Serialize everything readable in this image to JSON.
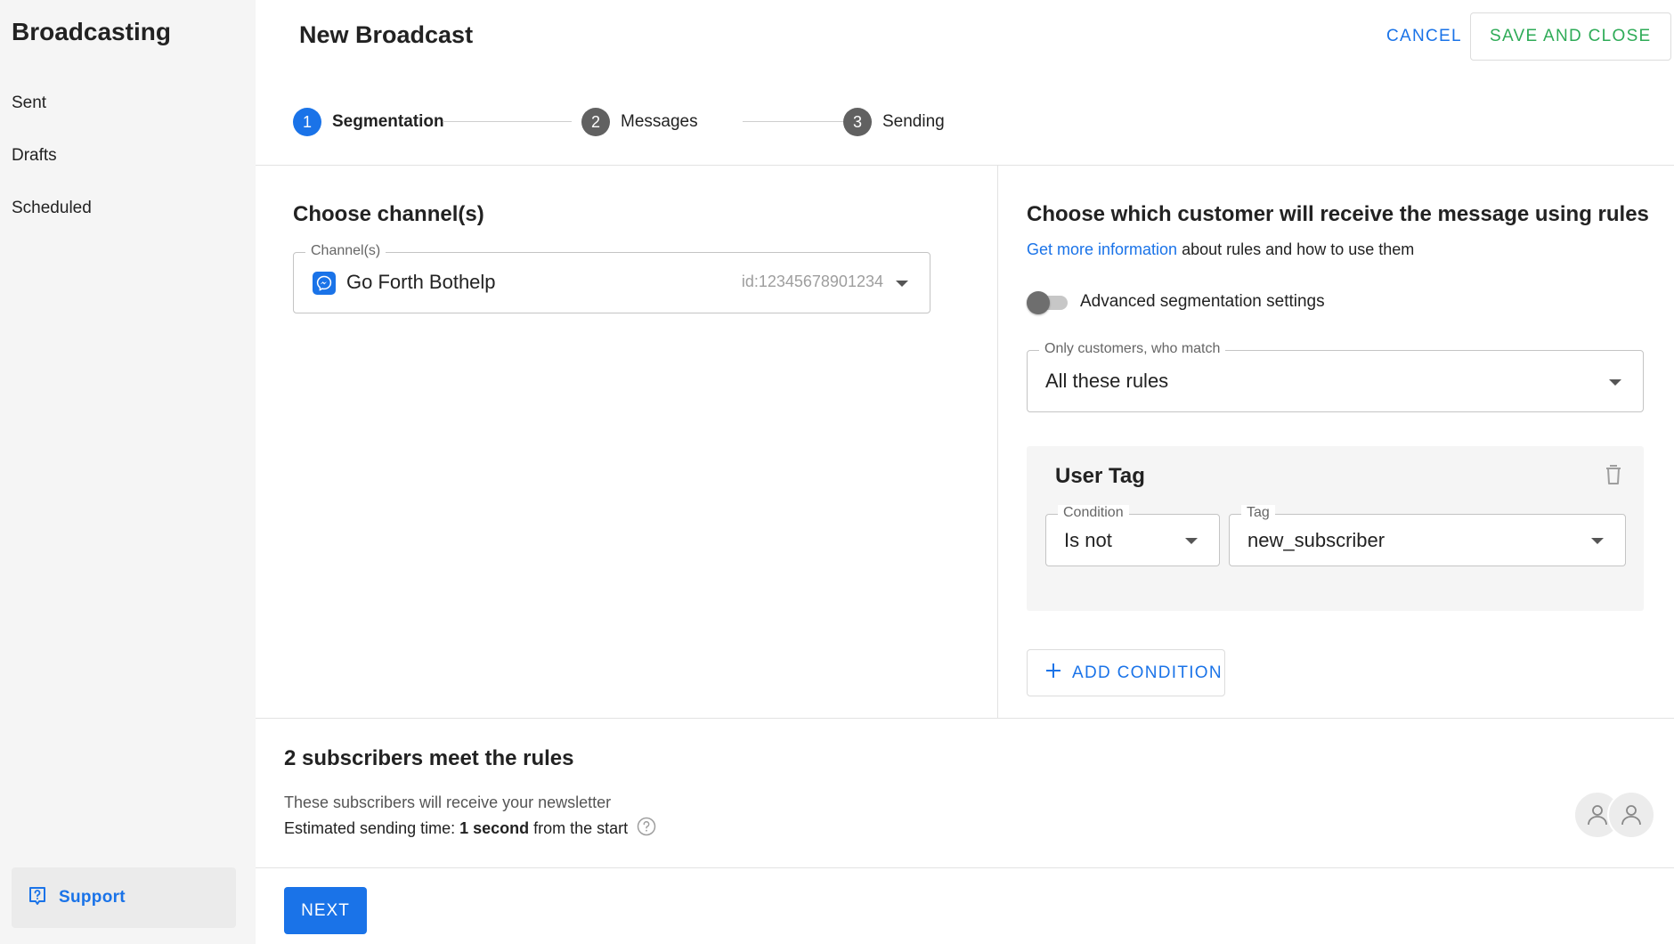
{
  "sidebar": {
    "title": "Broadcasting",
    "items": [
      {
        "label": "Sent"
      },
      {
        "label": "Drafts"
      },
      {
        "label": "Scheduled"
      }
    ],
    "support_label": "Support"
  },
  "header": {
    "title": "New Broadcast",
    "cancel_label": "CANCEL",
    "save_label": "SAVE AND CLOSE"
  },
  "stepper": {
    "steps": [
      {
        "number": "1",
        "label": "Segmentation",
        "active": true
      },
      {
        "number": "2",
        "label": "Messages",
        "active": false
      },
      {
        "number": "3",
        "label": "Sending",
        "active": false
      }
    ]
  },
  "channels": {
    "title": "Choose channel(s)",
    "field_label": "Channel(s)",
    "channel_name": "Go Forth Bothelp",
    "channel_id": "id:12345678901234"
  },
  "rules": {
    "title": "Choose which customer will receive the message using rules",
    "info_link": "Get more information",
    "info_text": " about rules and how to use them",
    "advanced_toggle_label": "Advanced segmentation settings",
    "advanced_enabled": false,
    "match_label": "Only customers, who match",
    "match_value": "All these rules",
    "rule_card": {
      "title": "User Tag",
      "condition_label": "Condition",
      "condition_value": "Is not",
      "tag_label": "Tag",
      "tag_value": "new_subscriber"
    },
    "add_condition_label": "ADD CONDITION"
  },
  "summary": {
    "title": "2 subscribers meet the rules",
    "description": "These subscribers will receive your newsletter",
    "estimate_prefix": "Estimated sending time:",
    "estimate_value": "1 second",
    "estimate_suffix": "from the start"
  },
  "footer": {
    "next_label": "NEXT"
  },
  "colors": {
    "accent": "#1a73e8",
    "save": "#2eab57"
  }
}
